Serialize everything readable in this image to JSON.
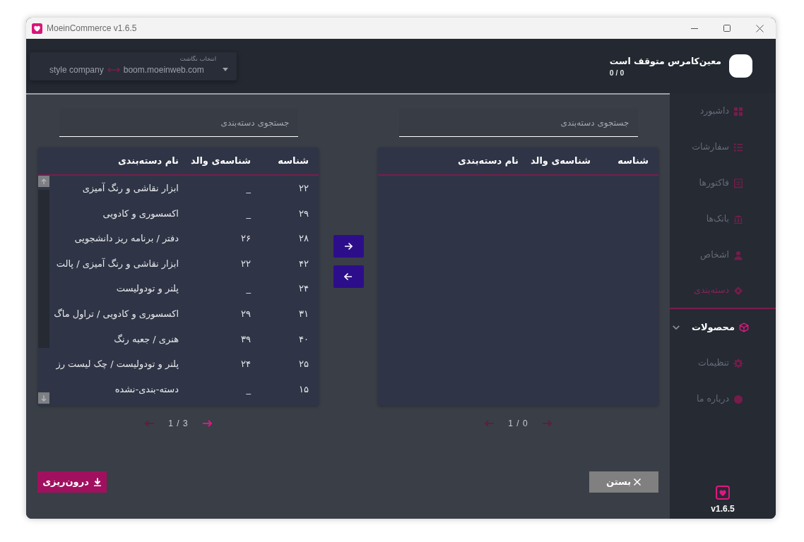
{
  "window": {
    "title": "MoeinCommerce v1.6.5"
  },
  "header": {
    "selector": {
      "label": "انتخاب نگاشت",
      "source": "style company",
      "target": "boom.moeinweb.com"
    },
    "status": {
      "title": "معین‌کامرس متوقف است",
      "counter": "0 / 0"
    }
  },
  "panels": [
    {
      "search": {
        "placeholder": "جستجوی دسته‌بندی"
      },
      "columns": [
        "شناسه",
        "شناسه‌ی والد",
        "نام دسته‌بندی"
      ],
      "pager": {
        "text": "1 / 0",
        "left_disabled": true,
        "right_disabled": true
      }
    },
    {
      "search": {
        "placeholder": "جستجوی دسته‌بندی"
      },
      "columns": [
        "شناسه",
        "شناسه‌ی والد",
        "نام دسته‌بندی"
      ],
      "rows": [
        [
          "۲۲",
          "_",
          "ابزار نقاشی و رنگ آمیزی"
        ],
        [
          "۲۹",
          "_",
          "اکسسوری و کادویی"
        ],
        [
          "۲۸",
          "۲۶",
          "دفتر / برنامه ریز دانشجویی"
        ],
        [
          "۴۲",
          "۲۲",
          "ابزار نقاشی و رنگ آمیزی / پالت"
        ],
        [
          "۲۴",
          "_",
          "پلنر و تودولیست"
        ],
        [
          "۳۱",
          "۲۹",
          "اکسسوری و کادویی / تراول ماگ"
        ],
        [
          "۴۰",
          "۳۹",
          "هنری / جعبه رنگ"
        ],
        [
          "۲۵",
          "۲۴",
          "پلنر و تودولیست / چک لیست رز"
        ],
        [
          "۱۵",
          "_",
          "دسته-بندی-نشده"
        ]
      ],
      "pager": {
        "text": "1 / 3",
        "left_disabled": true,
        "right_disabled": false
      }
    }
  ],
  "buttons": [
    {
      "kind": "close",
      "label": "بستن"
    },
    {
      "kind": "import",
      "label": "درون‌ریزی"
    }
  ],
  "sidebar": {
    "items": [
      {
        "kind": "link",
        "label": "داشبورد",
        "selected": false
      },
      {
        "kind": "link",
        "label": "سفارشات",
        "selected": false
      },
      {
        "kind": "link",
        "label": "فاکتورها",
        "selected": false
      },
      {
        "kind": "link",
        "label": "بانک‌ها",
        "selected": false
      },
      {
        "kind": "link",
        "label": "اشخاص",
        "selected": false
      },
      {
        "kind": "link",
        "label": "دسته‌بندی",
        "selected": true
      },
      {
        "kind": "group",
        "label": "محصولات",
        "selected": false,
        "expanded": true
      },
      {
        "kind": "link",
        "label": "تنظیمات",
        "selected": false
      },
      {
        "kind": "link",
        "label": "درباره ما",
        "selected": false
      }
    ],
    "version": "v1.6.5"
  }
}
